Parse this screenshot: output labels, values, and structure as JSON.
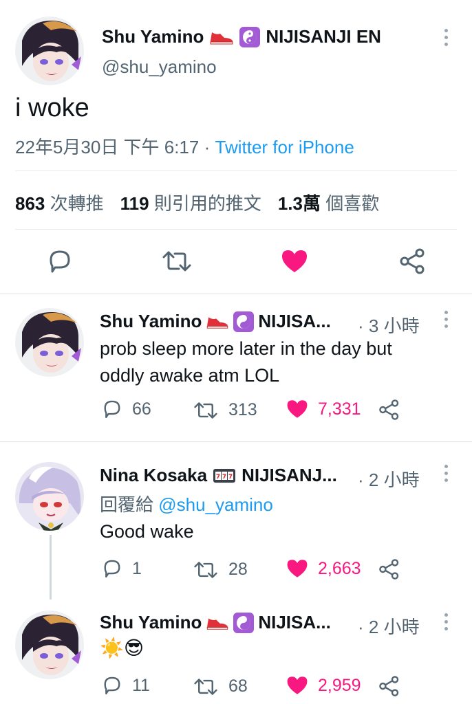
{
  "main_tweet": {
    "author_name": "Shu Yamino",
    "author_suffix": "NIJISANJI EN",
    "handle": "@shu_yamino",
    "text": "i woke",
    "timestamp": "22年5月30日 下午 6:17",
    "separator": "·",
    "source": "Twitter for iPhone",
    "stats": {
      "retweets_count": "863",
      "retweets_label": "次轉推",
      "quotes_count": "119",
      "quotes_label": "則引用的推文",
      "likes_count": "1.3萬",
      "likes_label": "個喜歡"
    }
  },
  "replies": [
    {
      "author_name": "Shu Yamino",
      "author_suffix": "NIJISA...",
      "time": "· 3 小時",
      "text": "prob sleep more later in the day but oddly awake atm LOL",
      "replies_count": "66",
      "retweets_count": "313",
      "likes_count": "7,331"
    },
    {
      "author_name": "Nina Kosaka",
      "author_suffix": "NIJISANJ...",
      "time": "· 2 小時",
      "reply_to_label": "回覆給",
      "reply_to_handle": "@shu_yamino",
      "text": "Good wake",
      "replies_count": "1",
      "retweets_count": "28",
      "likes_count": "2,663"
    },
    {
      "author_name": "Shu Yamino",
      "author_suffix": "NIJISA...",
      "time": "· 2 小時",
      "text": "☀️😎",
      "replies_count": "11",
      "retweets_count": "68",
      "likes_count": "2,959"
    }
  ],
  "colors": {
    "like": "#f91880",
    "link": "#1d9bf0",
    "muted": "#536471",
    "badge_purple": "#a25bd4"
  },
  "icons": [
    "more-icon",
    "reply-icon",
    "retweet-icon",
    "like-icon",
    "share-icon",
    "sneaker-emoji-icon",
    "yin-yang-icon",
    "slot-machine-icon"
  ]
}
